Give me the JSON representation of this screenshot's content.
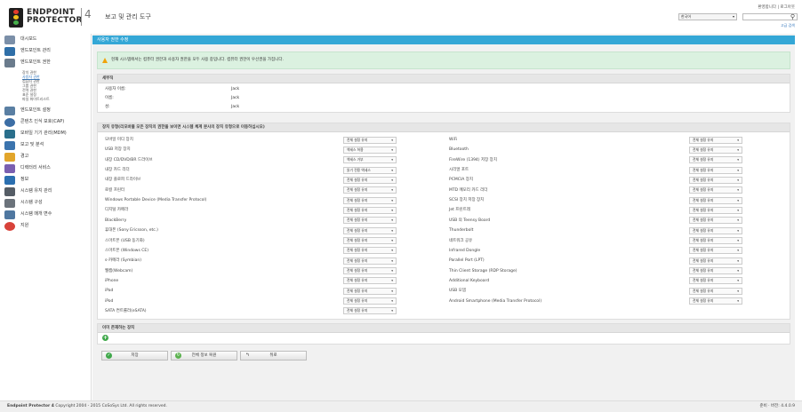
{
  "header": {
    "logo_line1": "ENDPOINT",
    "logo_line2": "PROTECTOR",
    "logo_version": "4",
    "app_title": "보고 및 관리 도구",
    "top_links": "환영합니다 | 로그아웃",
    "language": "한국어",
    "search_placeholder": "",
    "advanced_search": "고급 검색"
  },
  "sidebar": {
    "items": [
      {
        "label": "대시보드",
        "color": "#7b8fa8"
      },
      {
        "label": "엔드포인트 관리",
        "color": "#2f6fa8"
      },
      {
        "label": "엔드포인트 권한",
        "color": "#6a7b8c"
      }
    ],
    "subitems": [
      {
        "label": "장치 권한"
      },
      {
        "label": "사용자 권한"
      },
      {
        "label": "컴퓨터 권한"
      },
      {
        "label": "그룹 권한"
      },
      {
        "label": "전역 권한"
      },
      {
        "label": "표준 설정"
      },
      {
        "label": "파일 화이트리스트"
      }
    ],
    "items2": [
      {
        "label": "엔드포인트 설정",
        "color": "#5a7fa3"
      },
      {
        "label": "콘텐츠 인식 보호(CAP)",
        "color": "#3c6ea5"
      },
      {
        "label": "모바일 기기 관리(MDM)",
        "color": "#2a6f8c"
      },
      {
        "label": "보고 및 분석",
        "color": "#3b74ae"
      },
      {
        "label": "경고",
        "color": "#e2a52a"
      },
      {
        "label": "디렉터리 서비스",
        "color": "#7a5fb0"
      },
      {
        "label": "정보",
        "color": "#2b6fb0"
      },
      {
        "label": "시스템 유지 관리",
        "color": "#555d66"
      },
      {
        "label": "시스템 구성",
        "color": "#6b737b"
      },
      {
        "label": "시스템 매개 변수",
        "color": "#4f77a0"
      },
      {
        "label": "지원",
        "color": "#d8423a"
      }
    ]
  },
  "main": {
    "page_title": "사용자 권한 수정",
    "notice": "현재 시스템에서는 컴퓨터 권한과 사용자 권한을 모두 사용 중입니다. 컴퓨터 권한이 우선권을 가집니다.",
    "user_section": {
      "heading": "세부직",
      "rows": [
        {
          "key": "사용자 이름:",
          "value": "Jack"
        },
        {
          "key": "이름:",
          "value": "Jack"
        },
        {
          "key": "성:",
          "value": "Jack"
        }
      ]
    },
    "devices_heading": "장치 유형(리모바블 모든 장치의 권한을 보이면 시스템 체계 분사의 장치 유형으로 이동하십시오)",
    "devices_left": [
      {
        "name": "모바일 미디 장치",
        "value": "전체 설정 유지"
      },
      {
        "name": "USB 저장 장치",
        "value": "액세스 허용"
      },
      {
        "name": "내장 CD/DVD/BR 드라이브",
        "value": "액세스 거부"
      },
      {
        "name": "내장 카드 리더",
        "value": "읽기 전용 액세스"
      },
      {
        "name": "내장 플로피 드라이브",
        "value": "전체 설정 유지"
      },
      {
        "name": "로컬 프린터",
        "value": "전체 설정 유지"
      },
      {
        "name": "Windows Portable Device (Media Transfer Protocol)",
        "value": "전체 설정 유지"
      },
      {
        "name": "디지털 카메라",
        "value": "전체 설정 유지"
      },
      {
        "name": "BlackBerry",
        "value": "전체 설정 유지"
      },
      {
        "name": "휴대폰 (Sony Ericsson, etc.)",
        "value": "전체 설정 유지"
      },
      {
        "name": "스마트폰 (USB 동기화)",
        "value": "전체 설정 유지"
      },
      {
        "name": "스마트폰 (Windows CE)",
        "value": "전체 설정 유지"
      },
      {
        "name": "s-카메라 (Symbian)",
        "value": "전체 설정 유지"
      },
      {
        "name": "웹캠(Webcam)",
        "value": "전체 설정 유지"
      },
      {
        "name": "iPhone",
        "value": "전체 설정 유지"
      },
      {
        "name": "iPad",
        "value": "전체 설정 유지"
      },
      {
        "name": "iPod",
        "value": "전체 설정 유지"
      },
      {
        "name": "SATA 컨트롤러(eSATA)",
        "value": "전체 설정 유지"
      }
    ],
    "devices_right": [
      {
        "name": "WiFi",
        "value": "전체 설정 유지"
      },
      {
        "name": "Bluetooth",
        "value": "전체 설정 유지"
      },
      {
        "name": "FireWire (1394) 저장 장치",
        "value": "전체 설정 유지"
      },
      {
        "name": "시리얼 포트",
        "value": "전체 설정 유지"
      },
      {
        "name": "PCMCIA 장치",
        "value": "전체 설정 유지"
      },
      {
        "name": "MTD 메모리 카드 리더",
        "value": "전체 설정 유지"
      },
      {
        "name": "SCSI 장치 저장 장치",
        "value": "전체 설정 유지"
      },
      {
        "name": "Jet 프린트레",
        "value": "전체 설정 유지"
      },
      {
        "name": "USB 의 Teensy Board",
        "value": "전체 설정 유지"
      },
      {
        "name": "Thunderbolt",
        "value": "전체 설정 유지"
      },
      {
        "name": "네트워크 공유",
        "value": "전체 설정 유지"
      },
      {
        "name": "Infrared Dongle",
        "value": "전체 설정 유지"
      },
      {
        "name": "Parallel Port (LPT)",
        "value": "전체 설정 유지"
      },
      {
        "name": "Thin Client Storage (RDP Storage)",
        "value": "전체 설정 유지"
      },
      {
        "name": "Additional Keyboard",
        "value": "전체 설정 유지"
      },
      {
        "name": "USB 모뎀",
        "value": "전체 설정 유지"
      },
      {
        "name": "Android Smartphone (Media Transfer Protocol)",
        "value": "전체 설정 유지"
      }
    ],
    "custom_heading": "이미 존재하는 장치",
    "buttons": {
      "save": "저장",
      "reset": "전체 정보 복원",
      "back": "뒤로"
    }
  },
  "footer": {
    "brand": "Endpoint Protector 4",
    "copyright": "Copyright 2004 - 2015 CoSoSys Ltd. All rights reserved.",
    "version": "준비 · 버전: 4.4.0.9"
  }
}
